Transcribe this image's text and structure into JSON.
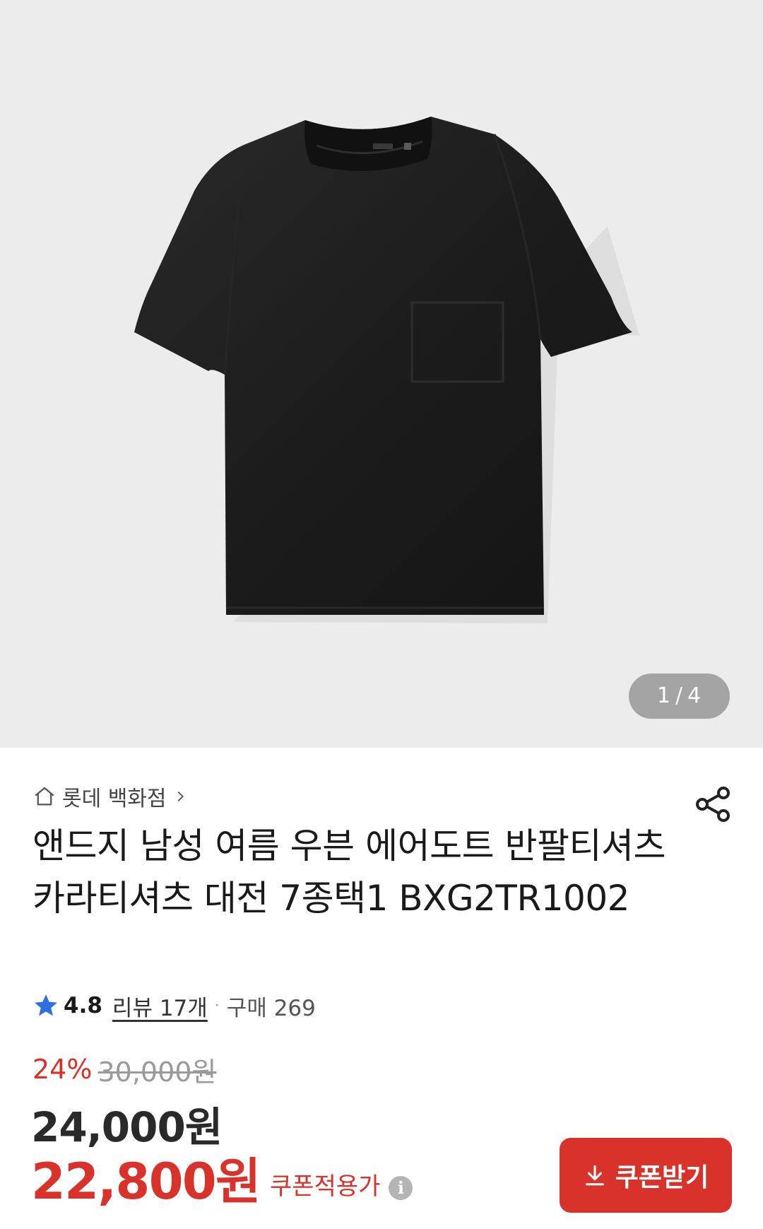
{
  "gallery": {
    "current": "1",
    "separator": "/",
    "total": "4",
    "image_alt": "black short-sleeve t-shirt with chest pocket"
  },
  "store": {
    "name": "롯데 백화점",
    "icon": "home-icon"
  },
  "product": {
    "title": "앤드지 남성 여름 우븐 에어도트 반팔티셔츠 카라티셔츠 대전 7종택1 BXG2TR1002"
  },
  "rating": {
    "score": "4.8",
    "review_label": "리뷰 17개",
    "separator": "·",
    "purchase_label": "구매 269"
  },
  "pricing": {
    "discount_rate": "24%",
    "original_price": "30,000원",
    "sale_price": "24,000원",
    "coupon_price": "22,800원",
    "coupon_label": "쿠폰적용가",
    "info_glyph": "i"
  },
  "coupon_button": {
    "label": "쿠폰받기",
    "icon": "download-icon"
  },
  "colors": {
    "accent": "#d9322b",
    "hero_bg": "#ececec",
    "star": "#2f6fe0"
  }
}
